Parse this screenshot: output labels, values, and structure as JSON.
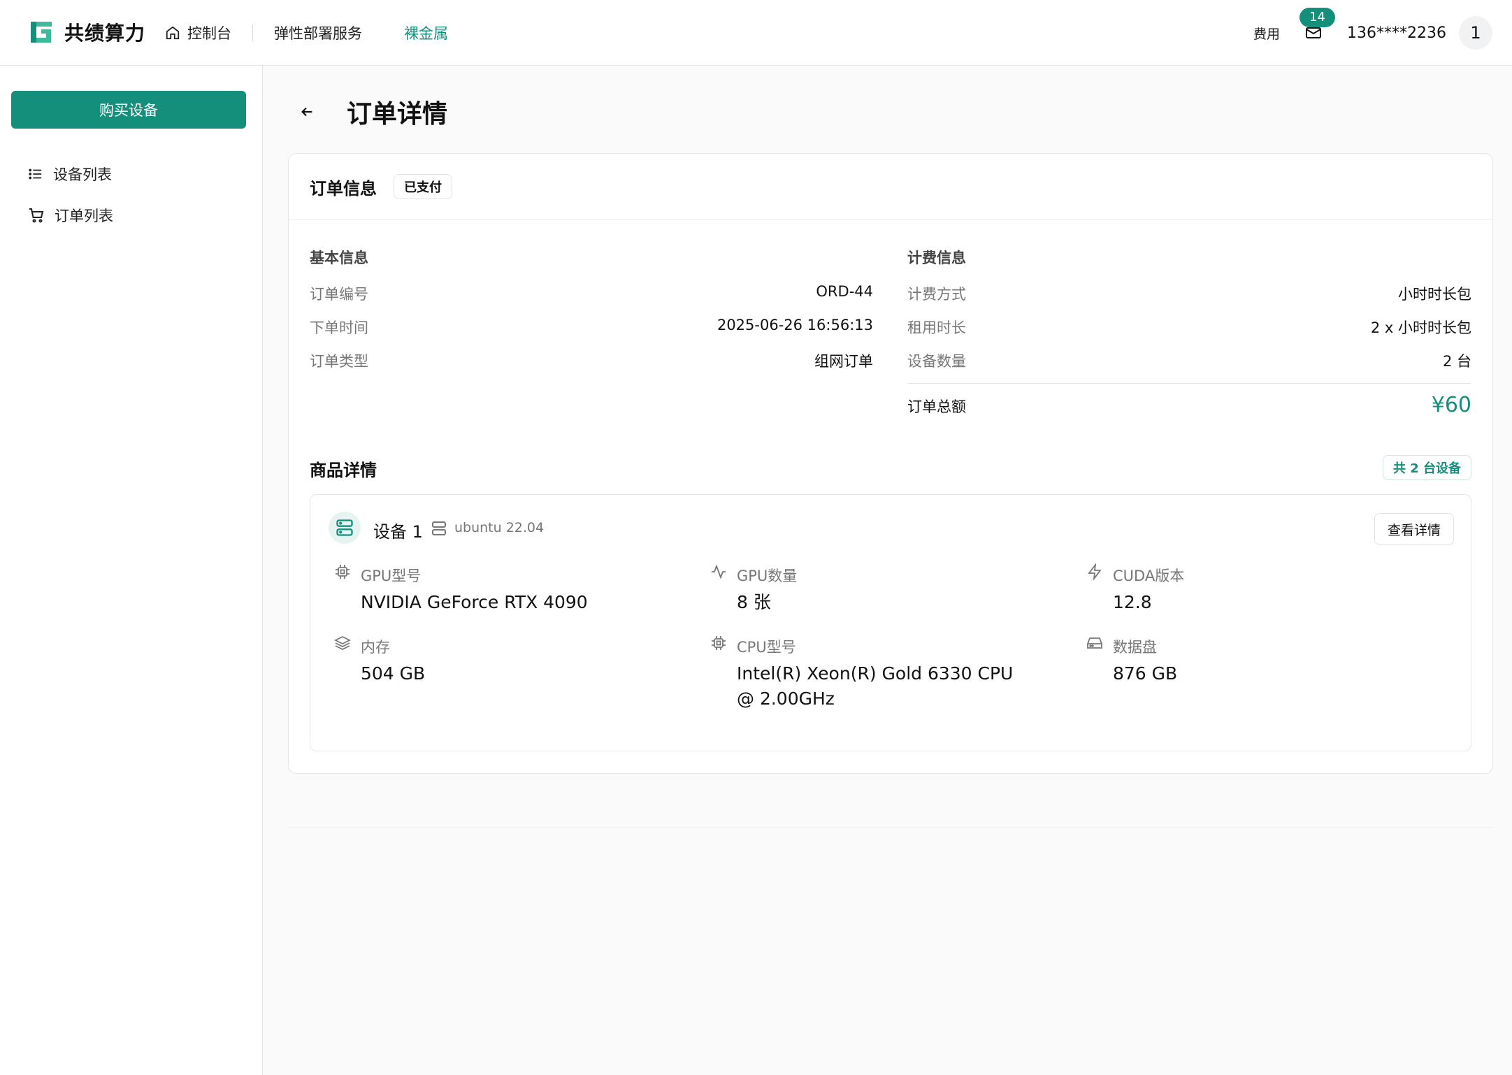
{
  "brand": {
    "name": "共绩算力",
    "accent": "#148f7c"
  },
  "nav": {
    "console": "控制台",
    "elastic": "弹性部署服务",
    "bare_metal": "裸金属"
  },
  "header": {
    "fee": "费用",
    "mail_count": "14",
    "phone": "136****2236",
    "avatar": "1"
  },
  "sidebar": {
    "buy": "购买设备",
    "items": [
      {
        "label": "设备列表",
        "icon": "list-icon"
      },
      {
        "label": "订单列表",
        "icon": "cart-icon"
      }
    ]
  },
  "page": {
    "title": "订单详情"
  },
  "order": {
    "title": "订单信息",
    "status": "已支付",
    "basic": {
      "title": "基本信息",
      "rows": [
        {
          "label": "订单编号",
          "value": "ORD-44"
        },
        {
          "label": "下单时间",
          "value": "2025-06-26 16:56:13"
        },
        {
          "label": "订单类型",
          "value": "组网订单"
        }
      ]
    },
    "billing": {
      "title": "计费信息",
      "rows": [
        {
          "label": "计费方式",
          "value": "小时时长包"
        },
        {
          "label": "租用时长",
          "value": "2 x 小时时长包"
        },
        {
          "label": "设备数量",
          "value": "2 台"
        }
      ],
      "total_label": "订单总额",
      "total_value": "¥60"
    }
  },
  "goods": {
    "title": "商品详情",
    "count": "共 2 台设备",
    "device": {
      "name": "设备 1",
      "os": "ubuntu 22.04",
      "detail_btn": "查看详情",
      "specs": [
        {
          "label": "GPU型号",
          "value": "NVIDIA GeForce RTX 4090",
          "icon": "chip-icon"
        },
        {
          "label": "GPU数量",
          "value": "8 张",
          "icon": "activity-icon"
        },
        {
          "label": "CUDA版本",
          "value": "12.8",
          "icon": "bolt-icon"
        },
        {
          "label": "内存",
          "value": "504 GB",
          "icon": "layers-icon"
        },
        {
          "label": "CPU型号",
          "value": "Intel(R) Xeon(R) Gold 6330 CPU @ 2.00GHz",
          "icon": "cpu-icon"
        },
        {
          "label": "数据盘",
          "value": "876 GB",
          "icon": "disk-icon"
        }
      ]
    }
  }
}
